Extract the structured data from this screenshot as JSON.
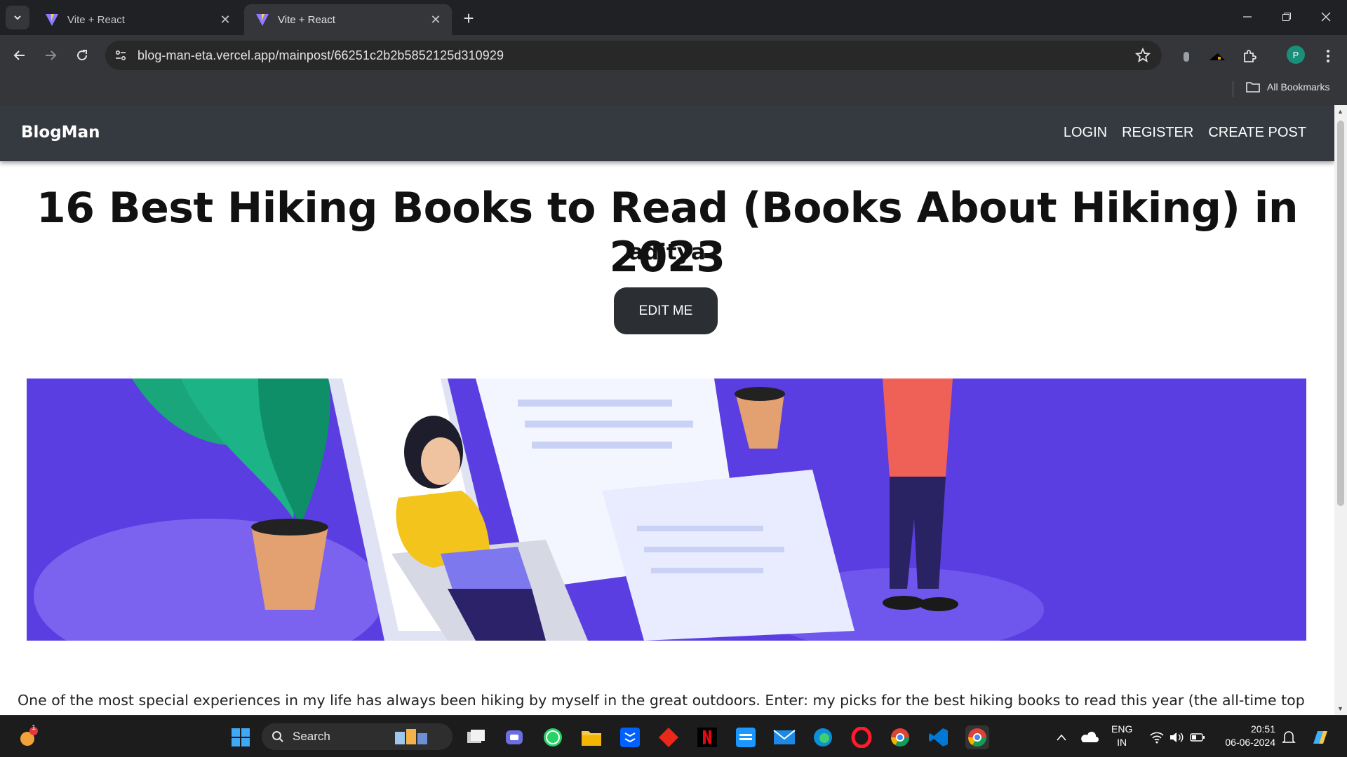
{
  "browser": {
    "tabs": [
      {
        "title": "Vite + React",
        "active": false
      },
      {
        "title": "Vite + React",
        "active": true
      }
    ],
    "url": "blog-man-eta.vercel.app/mainpost/66251c2b2b5852125d310929",
    "profile_initial": "P",
    "bookmarks_label": "All Bookmarks"
  },
  "site": {
    "brand": "BlogMan",
    "nav": {
      "login": "LOGIN",
      "register": "REGISTER",
      "create_post": "CREATE POST"
    }
  },
  "post": {
    "title": "16 Best Hiking Books to Read (Books About Hiking) in 2023",
    "author": "aditya",
    "edit_label": "EDIT ME",
    "body_first_line": "One of the most special experiences in my life has always been hiking by myself in the great outdoors. Enter: my picks for the best hiking books to read this year (the all-time top books"
  },
  "taskbar": {
    "search_placeholder": "Search",
    "notification_count": "1",
    "language": "ENG",
    "region": "IN",
    "time": "20:51",
    "date": "06-06-2024"
  },
  "colors": {
    "nav_bg": "#343a40",
    "hero_bg": "#5a3fe0",
    "edit_button_bg": "#2b2f33"
  }
}
